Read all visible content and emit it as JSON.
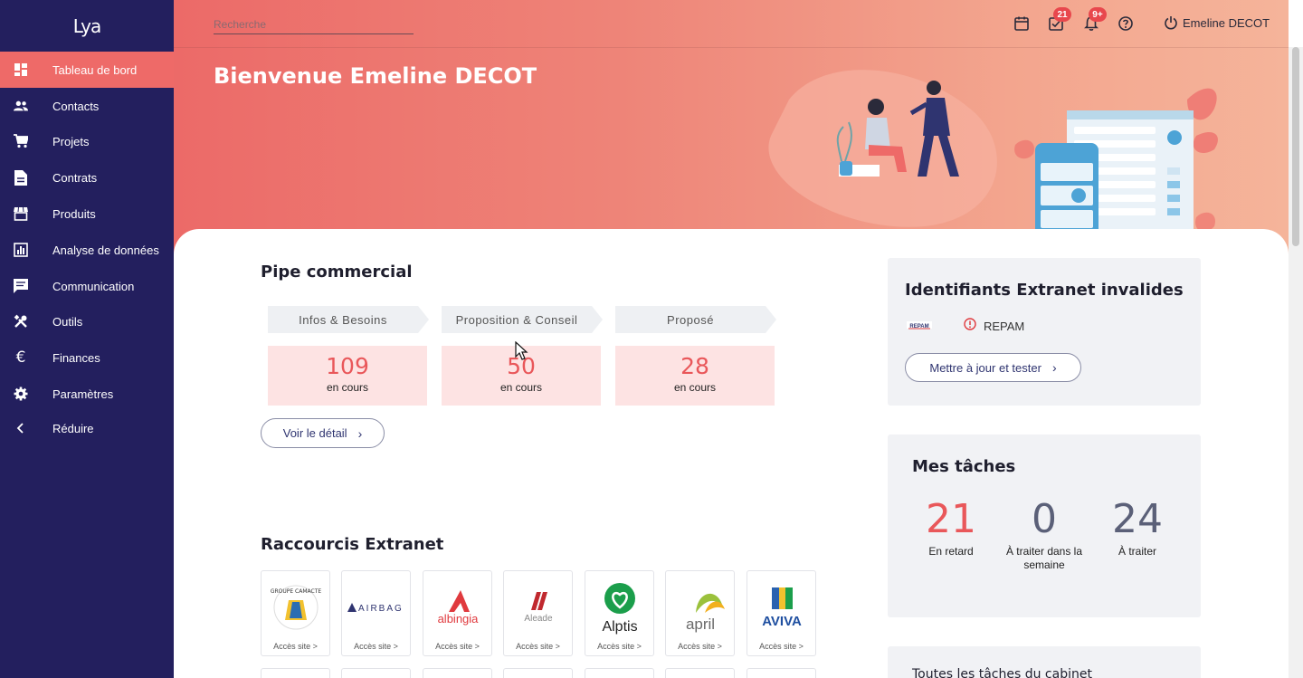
{
  "app": {
    "logo_text": "Lya"
  },
  "sidebar": {
    "items": [
      {
        "label": "Tableau de bord",
        "icon": "dashboard-icon"
      },
      {
        "label": "Contacts",
        "icon": "people-icon"
      },
      {
        "label": "Projets",
        "icon": "cart-icon"
      },
      {
        "label": "Contrats",
        "icon": "document-icon"
      },
      {
        "label": "Produits",
        "icon": "store-icon"
      },
      {
        "label": "Analyse de données",
        "icon": "analytics-icon"
      },
      {
        "label": "Communication",
        "icon": "message-icon"
      },
      {
        "label": "Outils",
        "icon": "tools-icon"
      },
      {
        "label": "Finances",
        "icon": "euro-icon"
      },
      {
        "label": "Paramètres",
        "icon": "gear-icon"
      },
      {
        "label": "Réduire",
        "icon": "chevron-left-icon"
      }
    ]
  },
  "topbar": {
    "search_placeholder": "Recherche",
    "tasks_badge": "21",
    "notifications_badge": "9+",
    "user_name": "Emeline DECOT"
  },
  "banner": {
    "welcome": "Bienvenue Emeline DECOT"
  },
  "pipe": {
    "title": "Pipe commercial",
    "stages": [
      {
        "label": "Infos & Besoins",
        "count": "109",
        "sub": "en cours"
      },
      {
        "label": "Proposition & Conseil",
        "count": "50",
        "sub": "en cours"
      },
      {
        "label": "Proposé",
        "count": "28",
        "sub": "en cours"
      }
    ],
    "detail_button": "Voir le détail"
  },
  "shortcuts": {
    "title": "Raccourcis Extranet",
    "tiles": [
      {
        "name": "GROUPE CAMACTE",
        "caption": "Accès site >"
      },
      {
        "name": "AIRBAG",
        "caption": "Accès site >"
      },
      {
        "name": "albingia",
        "caption": "Accès site >"
      },
      {
        "name": "Aleade",
        "caption": "Accès site >"
      },
      {
        "name": "Alptis",
        "caption": "Accès site >"
      },
      {
        "name": "april",
        "caption": "Accès site >"
      },
      {
        "name": "AVIVA",
        "caption": "Accès site >"
      }
    ]
  },
  "extranet": {
    "title": "Identifiants Extranet invalides",
    "logo_text": "REPAM",
    "item": "REPAM",
    "button": "Mettre à jour et tester"
  },
  "tasks": {
    "title": "Mes tâches",
    "late": {
      "value": "21",
      "label": "En retard"
    },
    "week": {
      "value": "0",
      "label": "À traiter dans la semaine"
    },
    "todo": {
      "value": "24",
      "label": "À traiter"
    }
  },
  "cabinet": {
    "title": "Toutes les tâches du cabinet"
  },
  "colors": {
    "sidebar": "#231f5e",
    "accent": "#ee6a68",
    "badge": "#e8474d"
  }
}
